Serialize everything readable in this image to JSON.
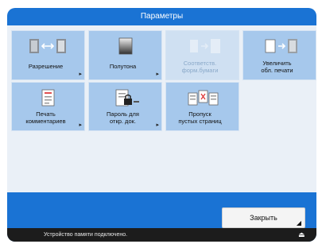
{
  "window": {
    "title": "Параметры"
  },
  "tiles": [
    {
      "label": "Разрешение",
      "icon": "resolution-icon",
      "enabled": true
    },
    {
      "label": "Полутона",
      "icon": "halftone-icon",
      "enabled": true
    },
    {
      "label": "Соответств. форм.бумаги",
      "icon": "paper-size-match-icon",
      "enabled": false
    },
    {
      "label": "Увеличить\nобл. печати",
      "icon": "enlarge-print-area-icon",
      "enabled": true
    },
    {
      "label": "Печать\nкомментариев",
      "icon": "print-comments-icon",
      "enabled": true
    },
    {
      "label": "Пароль для\nоткр. док.",
      "icon": "document-password-icon",
      "enabled": true
    },
    {
      "label": "Пропуск\nпустых страниц",
      "icon": "skip-blank-pages-icon",
      "enabled": true
    }
  ],
  "footer": {
    "close_label": "Закрыть"
  },
  "status": {
    "message": "Устройство памяти подключено.",
    "eject_icon": "eject-icon"
  },
  "colors": {
    "accent": "#1a73d4",
    "tile": "#a6c8ec",
    "tile_disabled": "#cfe0f2",
    "panel": "#eaf0f7",
    "statusbar": "#1c1c1c"
  }
}
